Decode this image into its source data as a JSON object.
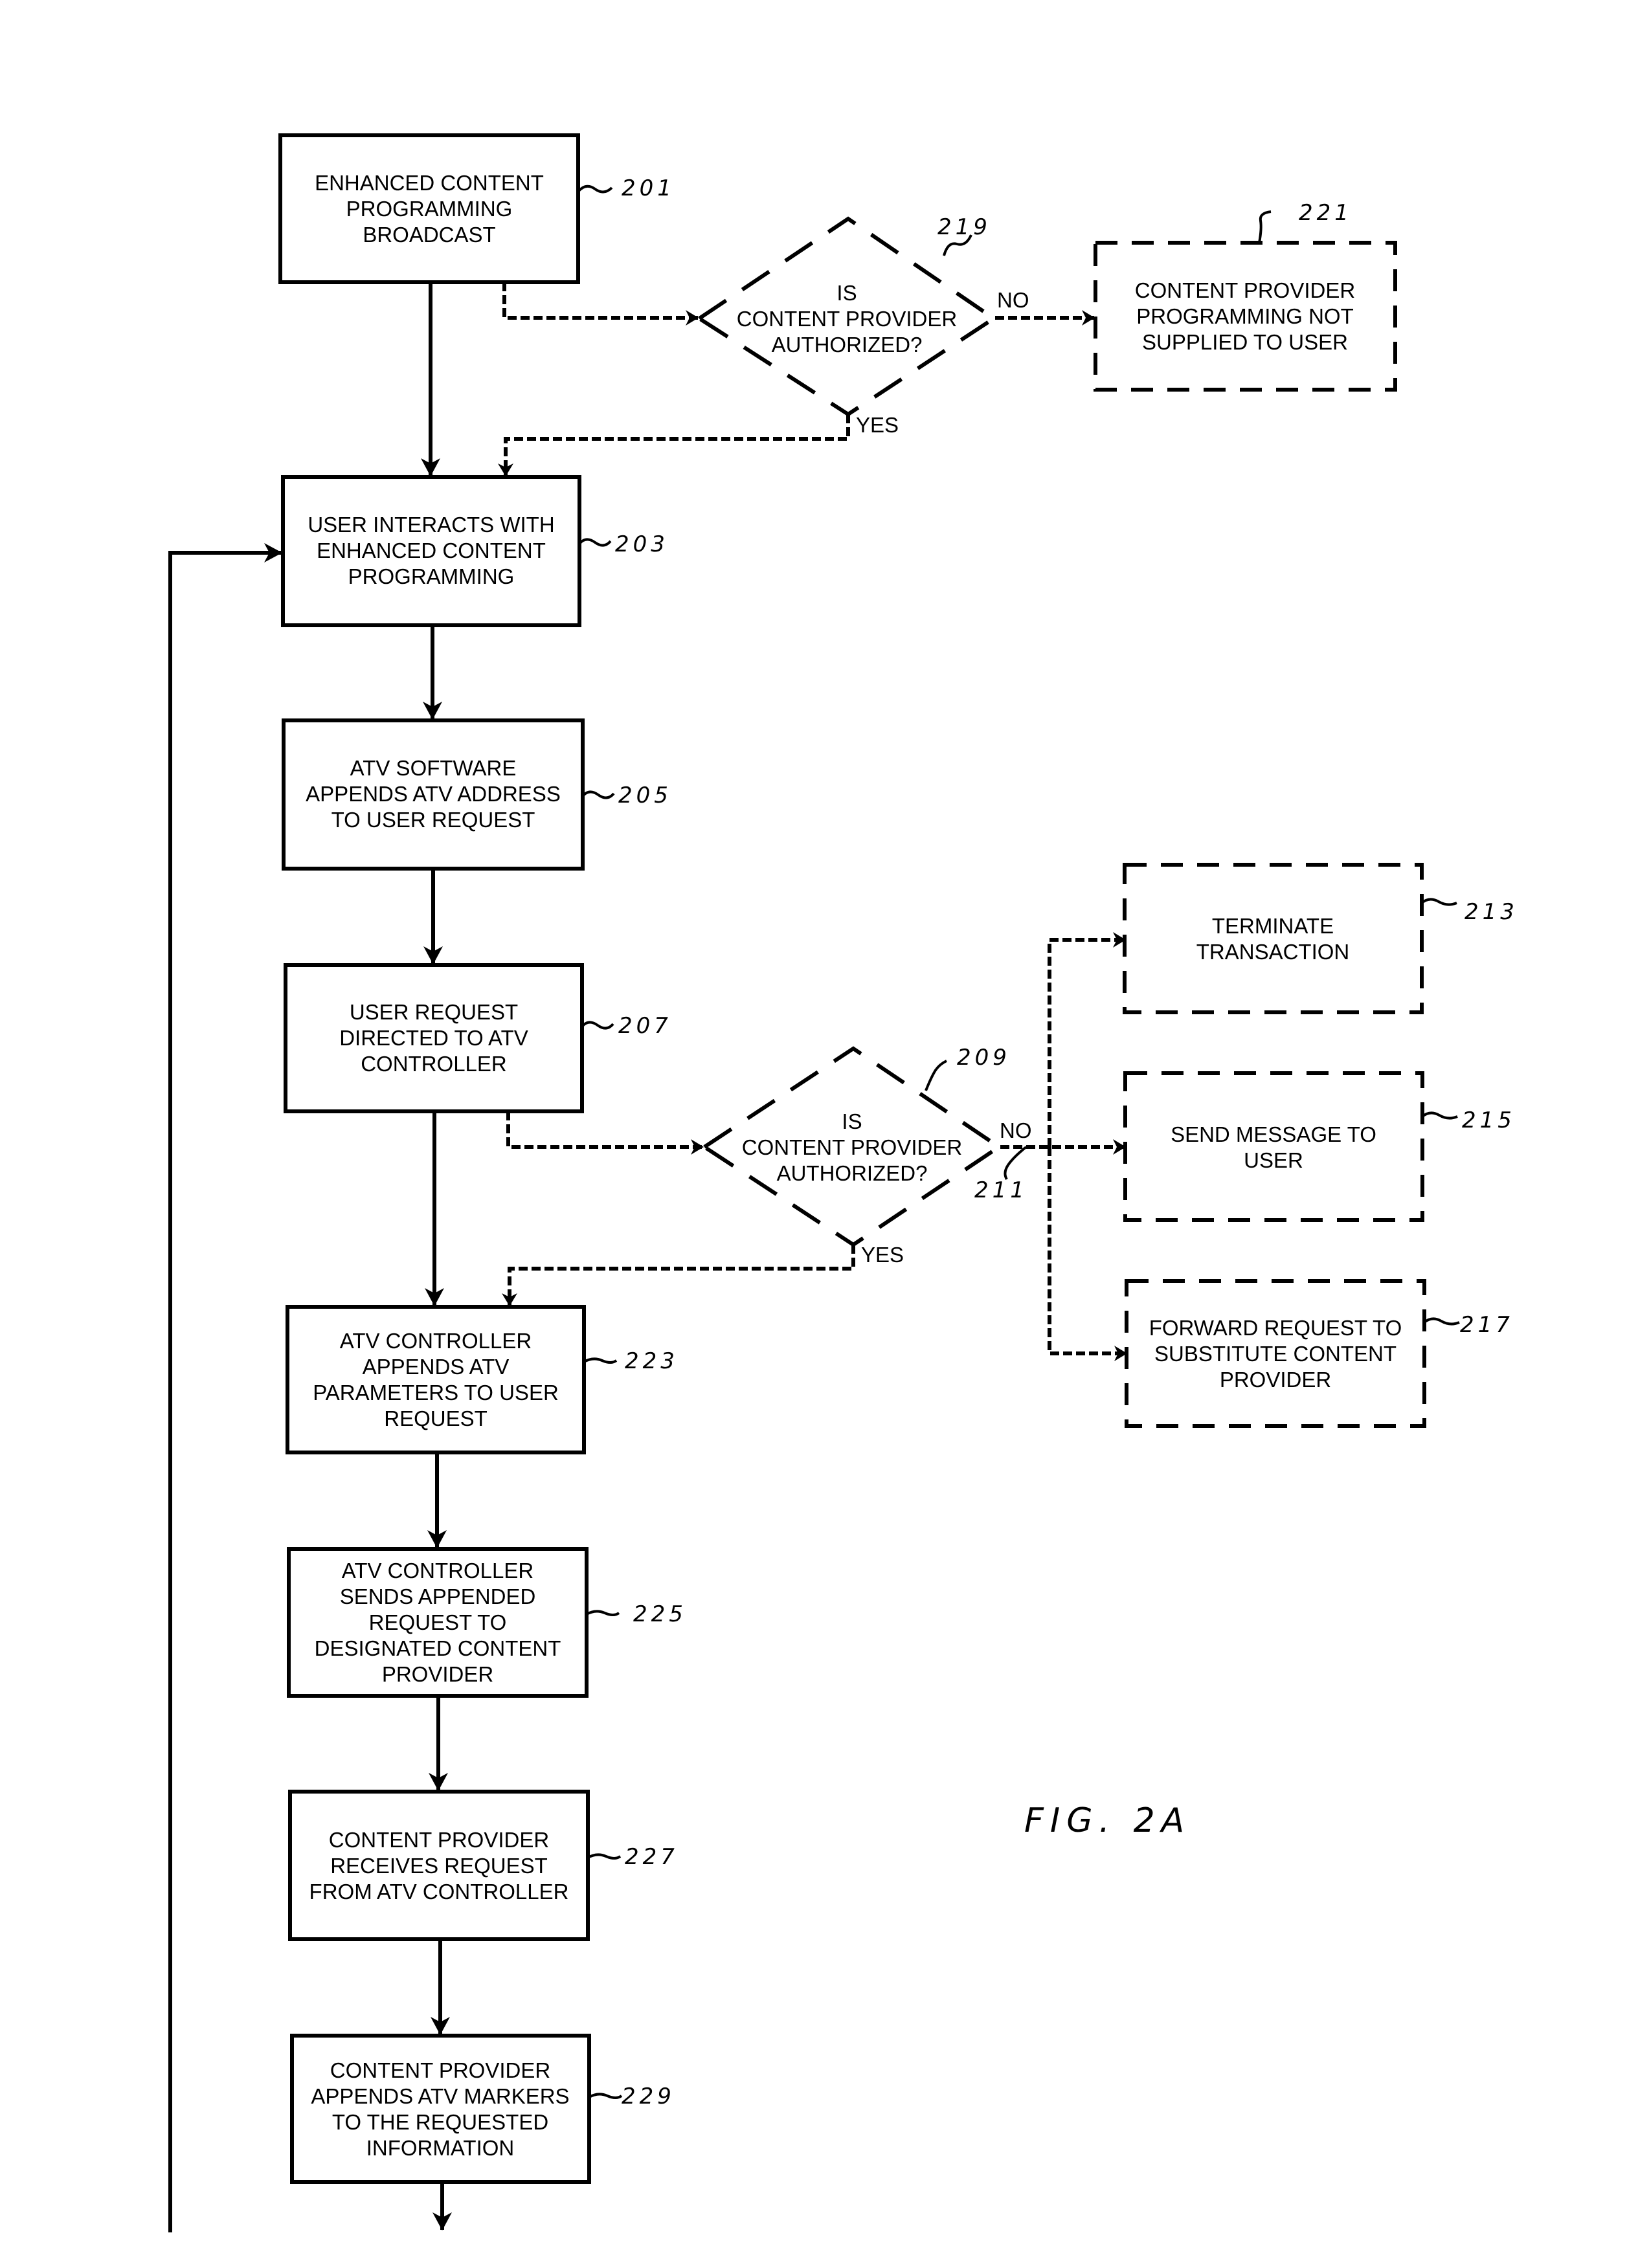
{
  "figure": {
    "label": "FIG. 2A"
  },
  "steps": [
    {
      "id": "201",
      "ref": "201",
      "shape": "process",
      "style": "solid",
      "lines": [
        "ENHANCED CONTENT",
        "PROGRAMMING",
        "BROADCAST"
      ]
    },
    {
      "id": "219",
      "ref": "219",
      "shape": "decision",
      "style": "dashed",
      "lines": [
        "IS",
        "CONTENT PROVIDER",
        "AUTHORIZED?"
      ]
    },
    {
      "id": "221",
      "ref": "221",
      "shape": "process",
      "style": "dashed",
      "lines": [
        "CONTENT PROVIDER",
        "PROGRAMMING NOT",
        "SUPPLIED TO USER"
      ]
    },
    {
      "id": "203",
      "ref": "203",
      "shape": "process",
      "style": "solid",
      "lines": [
        "USER INTERACTS WITH",
        "ENHANCED CONTENT",
        "PROGRAMMING"
      ]
    },
    {
      "id": "205",
      "ref": "205",
      "shape": "process",
      "style": "solid",
      "lines": [
        "ATV SOFTWARE",
        "APPENDS ATV ADDRESS",
        "TO USER REQUEST"
      ]
    },
    {
      "id": "207",
      "ref": "207",
      "shape": "process",
      "style": "solid",
      "lines": [
        "USER REQUEST",
        "DIRECTED TO ATV",
        "CONTROLLER"
      ]
    },
    {
      "id": "209",
      "ref": "209",
      "shape": "decision",
      "style": "dashed",
      "lines": [
        "IS",
        "CONTENT PROVIDER",
        "AUTHORIZED?"
      ]
    },
    {
      "id": "213",
      "ref": "213",
      "shape": "process",
      "style": "dashed",
      "lines": [
        "TERMINATE",
        "TRANSACTION"
      ]
    },
    {
      "id": "215",
      "ref": "215",
      "shape": "process",
      "style": "dashed",
      "lines": [
        "SEND MESSAGE TO",
        "USER"
      ]
    },
    {
      "id": "217",
      "ref": "217",
      "shape": "process",
      "style": "dashed",
      "lines": [
        "FORWARD REQUEST TO",
        "SUBSTITUTE CONTENT",
        "PROVIDER"
      ]
    },
    {
      "id": "223",
      "ref": "223",
      "shape": "process",
      "style": "solid",
      "lines": [
        "ATV CONTROLLER",
        "APPENDS ATV",
        "PARAMETERS TO USER",
        "REQUEST"
      ]
    },
    {
      "id": "225",
      "ref": "225",
      "shape": "process",
      "style": "solid",
      "lines": [
        "ATV CONTROLLER",
        "SENDS APPENDED",
        "REQUEST TO",
        "DESIGNATED CONTENT",
        "PROVIDER"
      ]
    },
    {
      "id": "227",
      "ref": "227",
      "shape": "process",
      "style": "solid",
      "lines": [
        "CONTENT PROVIDER",
        "RECEIVES REQUEST",
        "FROM ATV CONTROLLER"
      ]
    },
    {
      "id": "229",
      "ref": "229",
      "shape": "process",
      "style": "solid",
      "lines": [
        "CONTENT PROVIDER",
        "APPENDS ATV MARKERS",
        "TO THE REQUESTED",
        "INFORMATION"
      ]
    }
  ],
  "branches": {
    "d219_no": "NO",
    "d219_yes": "YES",
    "d209_no": "NO",
    "d209_yes": "YES",
    "d209_no_ref": "211"
  },
  "connections": [
    {
      "from": "201",
      "to": "203",
      "style": "solid"
    },
    {
      "from": "201",
      "to": "219",
      "style": "dashed"
    },
    {
      "from": "219",
      "to": "221",
      "style": "dashed",
      "label": "NO"
    },
    {
      "from": "219",
      "to": "203",
      "style": "dashed",
      "label": "YES"
    },
    {
      "from": "203",
      "to": "205",
      "style": "solid"
    },
    {
      "from": "205",
      "to": "207",
      "style": "solid"
    },
    {
      "from": "207",
      "to": "223",
      "style": "solid"
    },
    {
      "from": "207",
      "to": "209",
      "style": "dashed"
    },
    {
      "from": "209",
      "to": "213",
      "style": "dashed",
      "label": "NO"
    },
    {
      "from": "209",
      "to": "215",
      "style": "dashed",
      "label": "NO"
    },
    {
      "from": "209",
      "to": "217",
      "style": "dashed",
      "label": "NO"
    },
    {
      "from": "209",
      "to": "223",
      "style": "dashed",
      "label": "YES"
    },
    {
      "from": "223",
      "to": "225",
      "style": "solid"
    },
    {
      "from": "225",
      "to": "227",
      "style": "solid"
    },
    {
      "from": "227",
      "to": "229",
      "style": "solid"
    },
    {
      "from": "229",
      "to": "continuation",
      "style": "solid"
    },
    {
      "from": "continuation-loop",
      "to": "203",
      "style": "solid"
    }
  ]
}
